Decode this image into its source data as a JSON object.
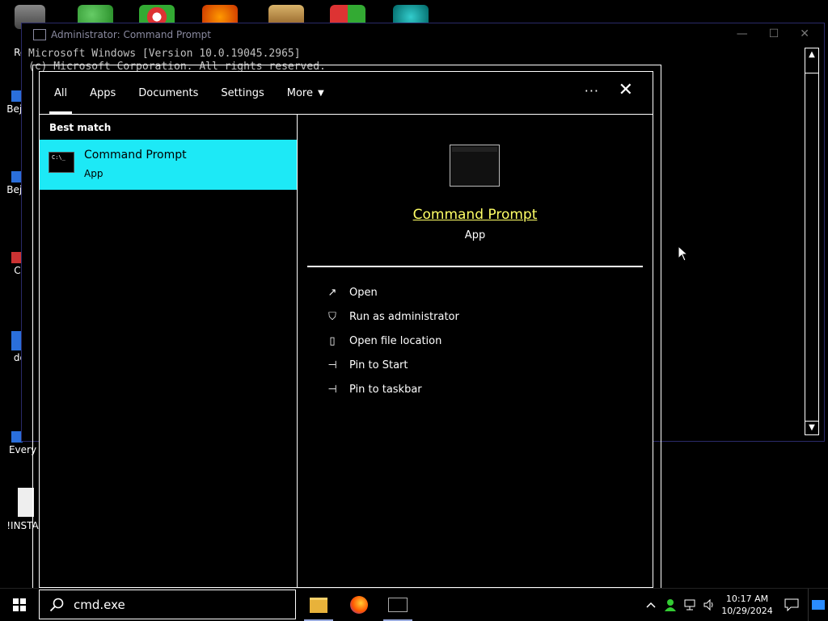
{
  "desktop": {
    "icons": [
      {
        "label": "Rec"
      },
      {
        "label": "Beje D"
      },
      {
        "label": "Beje D"
      },
      {
        "label": "C D"
      },
      {
        "label": "doe"
      },
      {
        "label": "Every"
      },
      {
        "label": "!INSTA"
      }
    ]
  },
  "cmd": {
    "title": "Administrator: Command Prompt",
    "line1": "Microsoft Windows [Version 10.0.19045.2965]",
    "line2": "(c) Microsoft Corporation. All rights reserved.",
    "minimize": "—",
    "maximize": "☐",
    "close": "✕"
  },
  "search": {
    "tabs": [
      {
        "label": "All"
      },
      {
        "label": "Apps"
      },
      {
        "label": "Documents"
      },
      {
        "label": "Settings"
      },
      {
        "label": "More"
      }
    ],
    "more_dots": "···",
    "close": "✕",
    "section_label": "Best match",
    "best_match": {
      "title": "Command Prompt",
      "subtitle": "App",
      "icon_text": "C:\\_"
    },
    "preview": {
      "title": "Command Prompt",
      "subtitle": "App"
    },
    "actions": [
      {
        "label": "Open",
        "icon": "↗"
      },
      {
        "label": "Run as administrator",
        "icon": "⛉"
      },
      {
        "label": "Open file location",
        "icon": "▯"
      },
      {
        "label": "Pin to Start",
        "icon": "⊣"
      },
      {
        "label": "Pin to taskbar",
        "icon": "⊣"
      }
    ]
  },
  "taskbar": {
    "search_value": "cmd.exe",
    "time": "10:17 AM",
    "date": "10/29/2024"
  }
}
